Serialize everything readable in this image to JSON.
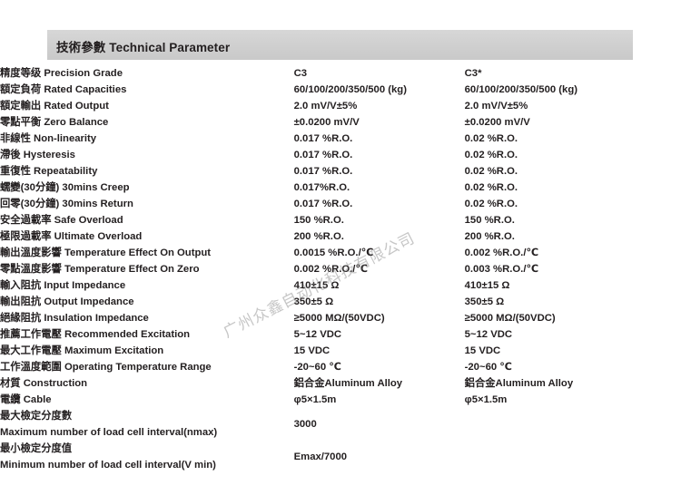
{
  "header": {
    "title": "技術參數 Technical Parameter"
  },
  "watermark": {
    "text": "广州众鑫自动化科技有限公司"
  },
  "columns": {
    "label_header": "",
    "value1_header": "",
    "value2_header": ""
  },
  "rows": [
    {
      "cn": "精度等级",
      "en": "Precision Grade",
      "v1": "C3",
      "v2": "C3*",
      "two_line": false
    },
    {
      "cn": "額定負荷",
      "en": "Rated Capacities",
      "v1": "60/100/200/350/500 (kg)",
      "v2": "60/100/200/350/500 (kg)",
      "two_line": false
    },
    {
      "cn": "額定輸出",
      "en": "Rated Output",
      "v1": "2.0 mV/V±5%",
      "v2": "2.0 mV/V±5%",
      "two_line": false
    },
    {
      "cn": "零點平衡",
      "en": "Zero Balance",
      "v1": "±0.0200 mV/V",
      "v2": "±0.0200 mV/V",
      "two_line": false
    },
    {
      "cn": "非線性",
      "en": "Non-linearity",
      "v1": "0.017 %R.O.",
      "v2": "0.02 %R.O.",
      "two_line": false
    },
    {
      "cn": "滯後",
      "en": "Hysteresis",
      "v1": "0.017 %R.O.",
      "v2": "0.02 %R.O.",
      "two_line": false
    },
    {
      "cn": "重復性",
      "en": "Repeatability",
      "v1": "0.017 %R.O.",
      "v2": "0.02 %R.O.",
      "two_line": false
    },
    {
      "cn": "蠕變(30分鐘)",
      "en": "30mins Creep",
      "v1": "0.017%R.O.",
      "v2": "0.02 %R.O.",
      "two_line": false
    },
    {
      "cn": "回零(30分鐘)",
      "en": "30mins Return",
      "v1": "0.017 %R.O.",
      "v2": "0.02 %R.O.",
      "two_line": false
    },
    {
      "cn": "安全過載率",
      "en": "Safe Overload",
      "v1": "150 %R.O.",
      "v2": "150 %R.O.",
      "two_line": false
    },
    {
      "cn": "極限過載率",
      "en": "Ultimate Overload",
      "v1": "200 %R.O.",
      "v2": "200 %R.O.",
      "two_line": false
    },
    {
      "cn": "輸出溫度影響",
      "en": "Temperature Effect On Output",
      "v1": "0.0015 %R.O./℃",
      "v2": "0.002 %R.O./℃",
      "two_line": false
    },
    {
      "cn": "零點溫度影響",
      "en": "Temperature Effect On Zero",
      "v1": "0.002 %R.O./℃",
      "v2": "0.003 %R.O./℃",
      "two_line": false
    },
    {
      "cn": "輸入阻抗",
      "en": "Input Impedance",
      "v1": "410±15 Ω",
      "v2": "410±15 Ω",
      "two_line": false
    },
    {
      "cn": "輸出阻抗",
      "en": "Output Impedance",
      "v1": "350±5 Ω",
      "v2": "350±5 Ω",
      "two_line": false
    },
    {
      "cn": "絕緣阻抗",
      "en": "Insulation Impedance",
      "v1": "≥5000 MΩ/(50VDC)",
      "v2": "≥5000 MΩ/(50VDC)",
      "two_line": false
    },
    {
      "cn": "推薦工作電壓",
      "en": "Recommended Excitation",
      "v1": "5~12 VDC",
      "v2": "5~12 VDC",
      "two_line": false
    },
    {
      "cn": "最大工作電壓",
      "en": "Maximum Excitation",
      "v1": "15 VDC",
      "v2": "15 VDC",
      "two_line": false
    },
    {
      "cn": "工作溫度範圍",
      "en": "Operating Temperature Range",
      "v1": "-20~60 ℃",
      "v2": "-20~60 ℃",
      "two_line": false
    },
    {
      "cn": "材質",
      "en": "Construction",
      "v1": "鋁合金Aluminum Alloy",
      "v2": "鋁合金Aluminum Alloy",
      "two_line": false
    },
    {
      "cn": "電纜",
      "en": "Cable",
      "v1": "φ5×1.5m",
      "v2": "φ5×1.5m",
      "two_line": false
    },
    {
      "cn": "最大檢定分度數",
      "en": "Maximum number of load cell interval(nmax)",
      "v1": "3000",
      "v2": "",
      "two_line": true
    },
    {
      "cn": "最小檢定分度值",
      "en": "Minimum number of load cell interval(V min)",
      "v1": "Emax/7000",
      "v2": "",
      "two_line": true
    }
  ]
}
